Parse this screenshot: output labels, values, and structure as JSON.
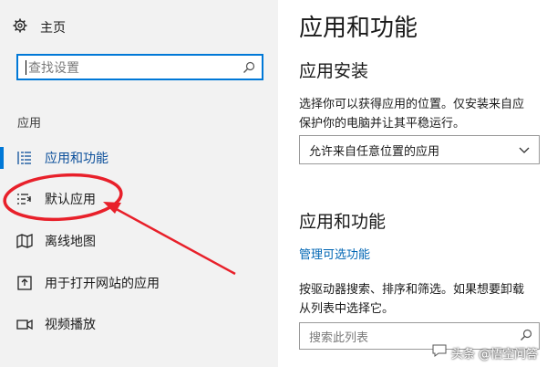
{
  "sidebar": {
    "home_label": "主页",
    "search_placeholder": "查找设置",
    "section_label": "应用",
    "items": [
      {
        "label": "应用和功能",
        "icon": "apps-features-icon",
        "active": true
      },
      {
        "label": "默认应用",
        "icon": "default-apps-icon",
        "active": false
      },
      {
        "label": "离线地图",
        "icon": "offline-maps-icon",
        "active": false
      },
      {
        "label": "用于打开网站的应用",
        "icon": "apps-for-websites-icon",
        "active": false
      },
      {
        "label": "视频播放",
        "icon": "video-playback-icon",
        "active": false
      }
    ]
  },
  "main": {
    "title": "应用和功能",
    "install_heading": "应用安装",
    "install_desc_line1": "选择你可以获得应用的位置。仅安装来自应",
    "install_desc_line2": "保护你的电脑并让其平稳运行。",
    "install_source_value": "允许来自任意位置的应用",
    "features_heading": "应用和功能",
    "manage_optional_link": "管理可选功能",
    "features_desc_line1": "按驱动器搜索、排序和筛选。如果想要卸载",
    "features_desc_line2": "从列表中选择它。",
    "search_list_placeholder": "搜索此列表"
  },
  "watermark": "头条 @悟空问答",
  "colors": {
    "accent": "#0078d7",
    "link": "#0066b4",
    "sidebar_bg": "#f2f2f2",
    "annotation_red": "#e8202a"
  }
}
